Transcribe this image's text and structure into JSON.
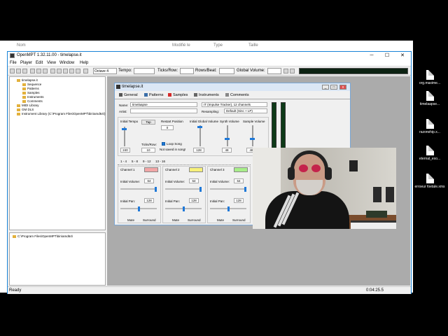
{
  "explorer": {
    "columns": [
      "Nom",
      "Modifié le",
      "Type",
      "Taille"
    ]
  },
  "desktop_icons": [
    "org.maxime...",
    "timelaapse...",
    "razorwhip.x...",
    "eternal_exo...",
    "erroeur foetale.xms"
  ],
  "window": {
    "title": "OpenMPT 1.32.11.00 - timelapse.it",
    "controls": [
      "─",
      "☐",
      "✕"
    ]
  },
  "menu": [
    "File",
    "Player",
    "Edit",
    "View",
    "Window",
    "Help"
  ],
  "toolbar": {
    "octave": "Octave 4",
    "tempo_label": "Tempo:",
    "ticks_label": "Ticks/Row:",
    "rows_label": "Rows/Beat:",
    "gv_label": "Global Volume:"
  },
  "tree": {
    "items": [
      "timelapse.it",
      "Sequence",
      "Patterns",
      "Samples",
      "Instruments",
      "Comments",
      "MIDI Library",
      "GM DLS",
      "Instrument Library (C:\\Program Files\\OpenMPT\\bin\\amd64\\)"
    ],
    "path": "C:\\Program Files\\OpenMPT\\bin\\amd64\\"
  },
  "status": {
    "left": "Ready",
    "right": "0:04:25.5"
  },
  "child": {
    "title": "timelapse.it",
    "tabs": [
      "General",
      "Patterns",
      "Samples",
      "Instruments",
      "Comments"
    ],
    "name_label": "Name:",
    "name_value": "timelaapse",
    "artist_label": "Artist:",
    "format": "IT (Impulse Tracker), 12 channels",
    "resampling_label": "Resampling:",
    "resampling_value": "Default (Sinc + LP)",
    "initial_tempo_label": "Initial Tempo",
    "tap_label": "Tap",
    "restart_label": "Restart Position",
    "restart_value": "0",
    "igv_label": "Initial Global Volume",
    "synth_label": "Synth Volume",
    "sample_vol_label": "Sample Volume",
    "tempo_value": "240",
    "ticks_label": "Ticks/Row:",
    "ticks_value": "10",
    "loop_label": "Loop Song",
    "not_saved": "Not saved in song!",
    "igv_value": "128",
    "synth_value": "48",
    "sample_value": "48",
    "channel_tabs": [
      "1 - 4",
      "5 - 8",
      "9 - 12",
      "13 - 16"
    ],
    "channels": [
      {
        "name": "Channel 1",
        "color": "#f2a6a6",
        "vol": "64",
        "pan": "128"
      },
      {
        "name": "Channel 2",
        "color": "#f7f07a",
        "vol": "64",
        "pan": "128"
      },
      {
        "name": "Channel 3",
        "color": "#a8ee8a",
        "vol": "64",
        "pan": "128"
      }
    ],
    "init_vol_label": "Initial Volume:",
    "init_pan_label": "Initial Pan:",
    "mute_label": "Mute",
    "surround_label": "Surround"
  }
}
